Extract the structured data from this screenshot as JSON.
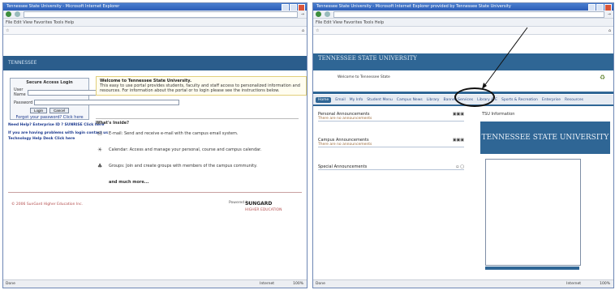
{
  "left_window": {
    "title": "Tennessee State University - Microsoft Internet Explorer",
    "menu": "File  Edit  View  Favorites  Tools  Help",
    "banner": "TENNESSEE",
    "login": {
      "title": "Secure Access Login",
      "user_label": "User Name",
      "password_label": "Password",
      "login_button": "Login",
      "cancel_button": "Cancel",
      "forgot": "Forgot your password? Click here"
    },
    "links": [
      "Need Help? Enterprise ID ? SUNRISE Click here",
      "If you are having problems with login contact us",
      "Technology Help Desk Click here"
    ],
    "welcome": {
      "heading": "Welcome to Tennessee State University.",
      "body": "This easy to use portal provides students, faculty and staff access to personalized information and resources. For information about the portal or to login please see the instructions below."
    },
    "whats_inside": "What's Inside?",
    "rows": [
      {
        "icon": "envelope-icon",
        "text": "E-mail: Send and receive e-mail with the campus email system."
      },
      {
        "icon": "calendar-icon",
        "text": "Calendar: Access and manage your personal, course and campus calendar."
      },
      {
        "icon": "people-icon",
        "text": "Groups: Join and create groups with members of the campus community."
      },
      {
        "icon": "",
        "text": "and much more..."
      }
    ],
    "copyright": "© 2006 SunGard Higher Education Inc.",
    "powered_by": "Powered by",
    "sungard": "SUNGARD",
    "sungard_sub": "HIGHER EDUCATION",
    "status": "Done",
    "zone": "Internet",
    "zoom": "100%"
  },
  "right_window": {
    "title": "Tennessee State University - Microsoft Internet Explorer provided by Tennessee State University",
    "menu": "File  Edit  View  Favorites  Tools  Help",
    "banner_logo": "TENNESSEE STATE UNIVERSITY",
    "welcome_line": "Welcome to Tennessee State",
    "tabs": [
      "Home",
      "Email",
      "My Info",
      "Student Menu",
      "Campus News",
      "Library",
      "Banner Services",
      "Library & E",
      "Sports & Recreation",
      "Enterprise",
      "Resources"
    ],
    "channels": [
      {
        "title": "Personal Announcements",
        "sub": "There are no announcements"
      },
      {
        "title": "Campus Announcements",
        "sub": "There are no announcements"
      },
      {
        "title": "Special Announcements",
        "sub": ""
      }
    ],
    "tsu_heading": "TSU Information",
    "tsu_logo": "TENNESSEE STATE UNIVERSITY",
    "status": "Done",
    "zone": "Internet",
    "zoom": "100%"
  }
}
